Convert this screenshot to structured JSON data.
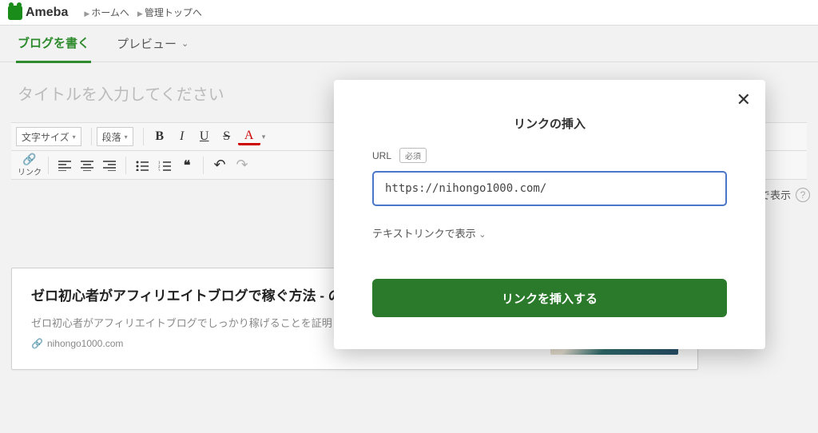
{
  "brand": {
    "name": "Ameba"
  },
  "header": {
    "home_link": "ホームへ",
    "admin_link": "管理トップへ"
  },
  "tabs": {
    "write": "ブログを書く",
    "preview": "プレビュー"
  },
  "editor": {
    "title_placeholder": "タイトルを入力してください"
  },
  "toolbar": {
    "font_size": "文字サイズ",
    "paragraph": "段落",
    "bold": "B",
    "italic": "I",
    "underline": "U",
    "strike": "S",
    "color": "A",
    "link_label": "リンク",
    "quote": "❝",
    "undo": "↶",
    "redo": "↷"
  },
  "display_mode": {
    "label": "幅で表示"
  },
  "link_card": {
    "title": "ゼロ初心者がアフィリエイトブログで稼ぐ方法 - の作り方と始め方を図解します。",
    "desc": "ゼロ初心者がアフィリエイトブログでしっかり稼げることを証明します！何から始…",
    "domain": "nihongo1000.com"
  },
  "modal": {
    "title": "リンクの挿入",
    "url_label": "URL",
    "required": "必須",
    "url_value": "https://nihongo1000.com/",
    "display_option": "テキストリンクで表示",
    "insert_button": "リンクを挿入する"
  }
}
